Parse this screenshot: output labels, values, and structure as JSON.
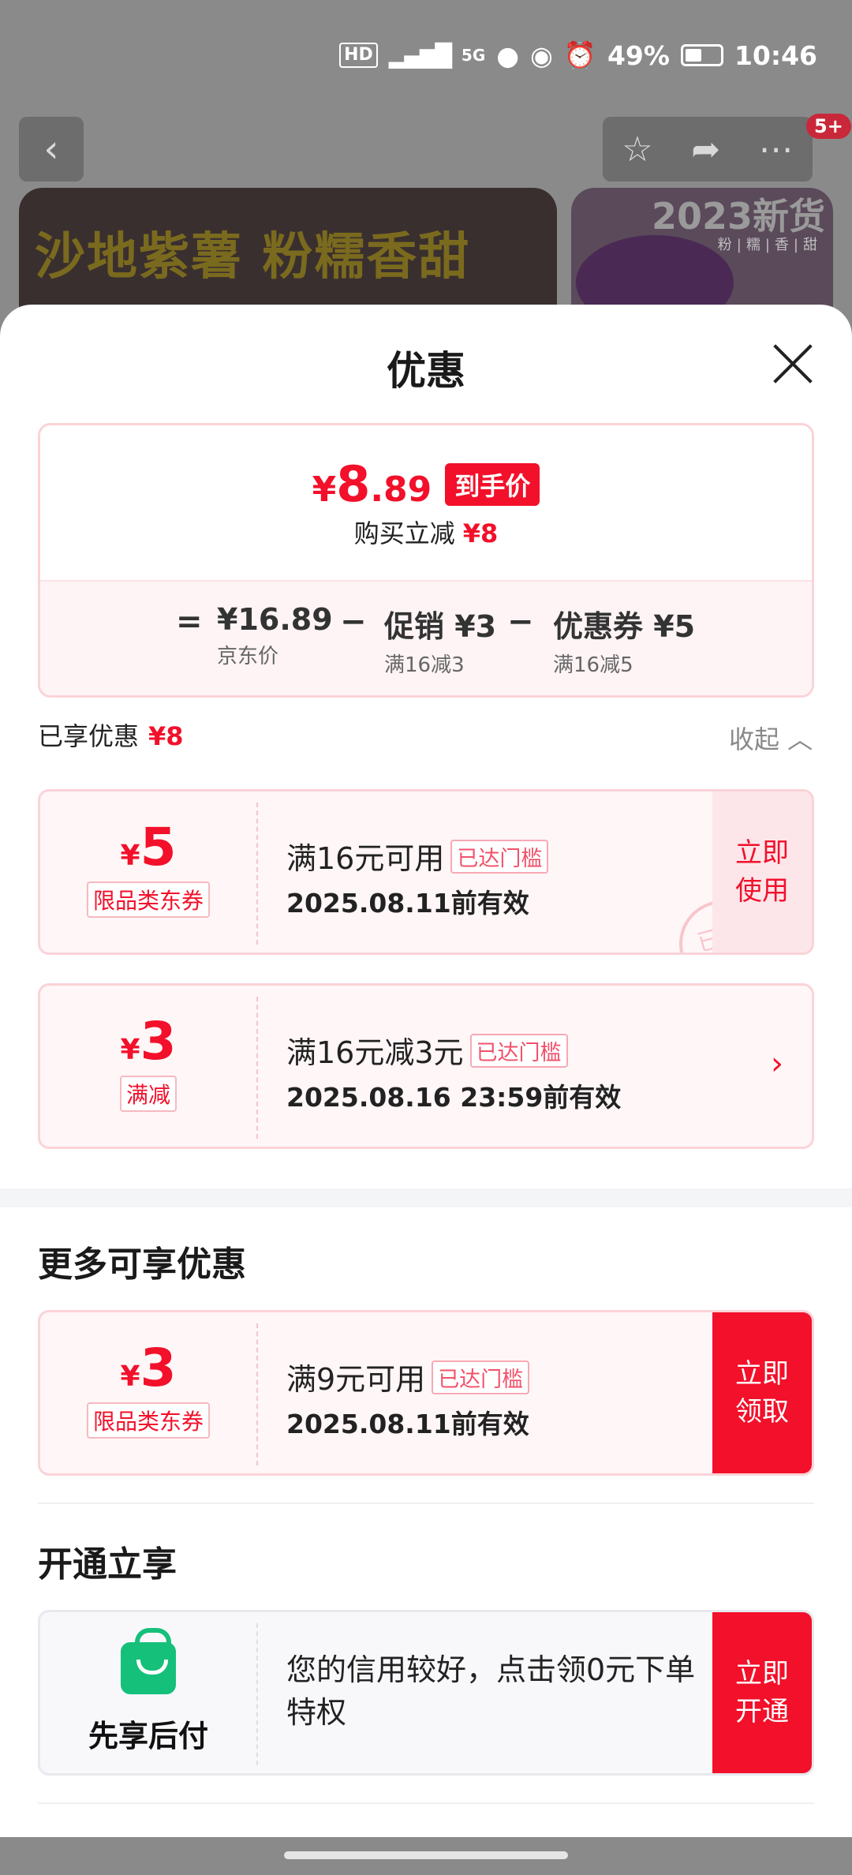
{
  "status_bar": {
    "network": "HD",
    "signal": "5G",
    "battery": "49%",
    "time": "10:46"
  },
  "background": {
    "badge": "5+",
    "banner_text": "沙地紫薯 粉糯香甜",
    "side_banner_year": "2023新货",
    "side_banner_sub": "粉|糯|香|甜"
  },
  "sheet": {
    "title": "优惠",
    "summary": {
      "currency": "¥",
      "final_int": "8",
      "final_dec": ".89",
      "final_tag": "到手价",
      "instant_off_label": "购买立减",
      "instant_off_value": "¥8",
      "eq": "=",
      "jd_price": "¥16.89",
      "jd_price_label": "京东价",
      "minus1": "−",
      "promo": "促销 ¥3",
      "promo_rule": "满16减3",
      "minus2": "−",
      "coupon": "优惠券 ¥5",
      "coupon_rule": "满16减5"
    },
    "enjoyed_label": "已享优惠",
    "enjoyed_value": "¥8",
    "collapse_label": "收起 ︿",
    "enjoyed_coupons": [
      {
        "currency": "¥",
        "amount": "5",
        "type": "限品类东券",
        "condition": "满16元可用",
        "status": "已达门槛",
        "validity": "2025.08.11前有效",
        "action": "立即\n使用",
        "stamp": "已领"
      },
      {
        "currency": "¥",
        "amount": "3",
        "type": "满减",
        "condition": "满16元减3元",
        "status": "已达门槛",
        "validity": "2025.08.16 23:59前有效",
        "chevron": "›"
      }
    ],
    "more_title": "更多可享优惠",
    "more_coupons": [
      {
        "currency": "¥",
        "amount": "3",
        "type": "限品类东券",
        "condition": "满9元可用",
        "status": "已达门槛",
        "validity": "2025.08.11前有效",
        "action": "立即\n领取"
      }
    ],
    "open_title": "开通立享",
    "pay_later": {
      "name": "先享后付",
      "desc": "您的信用较好，点击领0元下单特权",
      "action": "立即\n开通"
    }
  }
}
